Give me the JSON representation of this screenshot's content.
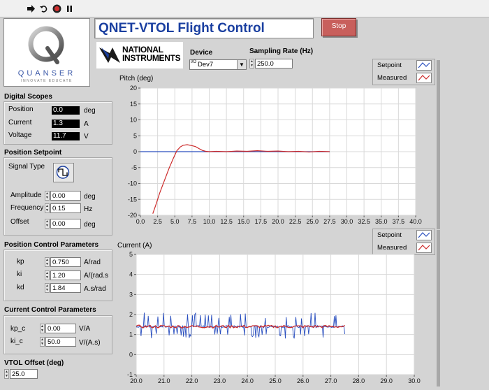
{
  "app": {
    "title": "QNET-VTOL Flight Control",
    "stop_label": "Stop",
    "logo_brand": "QUANSER",
    "logo_tagline": "INNOVATE EDUCATE",
    "ni_logo_line1": "NATIONAL",
    "ni_logo_line2": "INSTRUMENTS"
  },
  "device": {
    "label": "Device",
    "value": "Dev7",
    "prefix": "I/O"
  },
  "sampling": {
    "label": "Sampling Rate (Hz)",
    "value": "250.0"
  },
  "digital_scopes": {
    "title": "Digital Scopes",
    "position": {
      "label": "Position",
      "value": "0.0",
      "unit": "deg"
    },
    "current": {
      "label": "Current",
      "value": "1.3",
      "unit": "A"
    },
    "voltage": {
      "label": "Voltage",
      "value": "11.7",
      "unit": "V"
    }
  },
  "position_setpoint": {
    "title": "Position Setpoint",
    "signal_type_label": "Signal Type",
    "amplitude": {
      "label": "Amplitude",
      "value": "0.00",
      "unit": "deg"
    },
    "frequency": {
      "label": "Frequency",
      "value": "0.15",
      "unit": "Hz"
    },
    "offset": {
      "label": "Offset",
      "value": "0.00",
      "unit": "deg"
    }
  },
  "position_control": {
    "title": "Position Control Parameters",
    "kp": {
      "label": "kp",
      "value": "0.750",
      "unit": "A/rad"
    },
    "ki": {
      "label": "ki",
      "value": "1.20",
      "unit": "A/(rad.s"
    },
    "kd": {
      "label": "kd",
      "value": "1.84",
      "unit": "A.s/rad"
    }
  },
  "current_control": {
    "title": "Current Control Parameters",
    "kp_c": {
      "label": "kp_c",
      "value": "0.00",
      "unit": "V/A"
    },
    "ki_c": {
      "label": "ki_c",
      "value": "50.0",
      "unit": "V/(A.s)"
    }
  },
  "vtol_offset": {
    "title": "VTOL Offset (deg)",
    "value": "25.0"
  },
  "legend": {
    "setpoint": "Setpoint",
    "measured": "Measured"
  },
  "colors": {
    "setpoint": "#2a4fbf",
    "measured": "#cc2a2a",
    "title": "#1a3fa0",
    "stop": "#c85f5c"
  },
  "chart_data": [
    {
      "type": "line",
      "title": "Pitch (deg)",
      "xlim": [
        0,
        40
      ],
      "ylim": [
        -20,
        20
      ],
      "xticks": [
        "0.0",
        "2.5",
        "5.0",
        "7.5",
        "10.0",
        "12.5",
        "15.0",
        "17.5",
        "20.0",
        "22.5",
        "25.0",
        "27.5",
        "30.0",
        "32.5",
        "35.0",
        "37.5",
        "40.0"
      ],
      "yticks": [
        "20",
        "15",
        "10",
        "5",
        "0",
        "-5",
        "-10",
        "-15",
        "-20"
      ],
      "grid": true,
      "legend_position": "top-right",
      "series": [
        {
          "name": "Setpoint",
          "x": [
            0,
            27.5
          ],
          "y": [
            0,
            0
          ]
        },
        {
          "name": "Measured",
          "x": [
            1.8,
            2.2,
            2.8,
            3.5,
            4.2,
            4.8,
            5.3,
            5.8,
            6.2,
            6.8,
            7.5,
            8.0,
            8.5,
            9.0,
            9.5,
            10.0,
            11.0,
            12.5,
            14.0,
            15.5,
            17.0,
            18.5,
            20.0,
            21.5,
            23.0,
            24.5,
            26.0,
            27.5
          ],
          "y": [
            -19.5,
            -17,
            -13,
            -9,
            -5,
            -2,
            0.3,
            1.5,
            2.0,
            2.2,
            1.9,
            1.6,
            1.0,
            0.4,
            0.1,
            0.0,
            0.1,
            0.0,
            0.2,
            0.1,
            0.3,
            0.1,
            0.2,
            0.0,
            0.1,
            -0.1,
            0.1,
            0.0
          ]
        }
      ]
    },
    {
      "type": "line",
      "title": "Current (A)",
      "xlim": [
        20,
        30
      ],
      "ylim": [
        -1,
        5
      ],
      "xticks": [
        "20.0",
        "21.0",
        "22.0",
        "23.0",
        "24.0",
        "25.0",
        "26.0",
        "27.0",
        "28.0",
        "29.0",
        "30.0"
      ],
      "yticks": [
        "5",
        "4",
        "3",
        "2",
        "1",
        "0",
        "-1"
      ],
      "grid": true,
      "legend_position": "top-right",
      "series": [
        {
          "name": "Setpoint",
          "x_range": [
            20,
            27.5
          ],
          "baseline": 1.4,
          "noise": "spiky"
        },
        {
          "name": "Measured",
          "x_range": [
            20,
            27.5
          ],
          "baseline": 1.4,
          "noise": "smooth"
        }
      ]
    }
  ]
}
